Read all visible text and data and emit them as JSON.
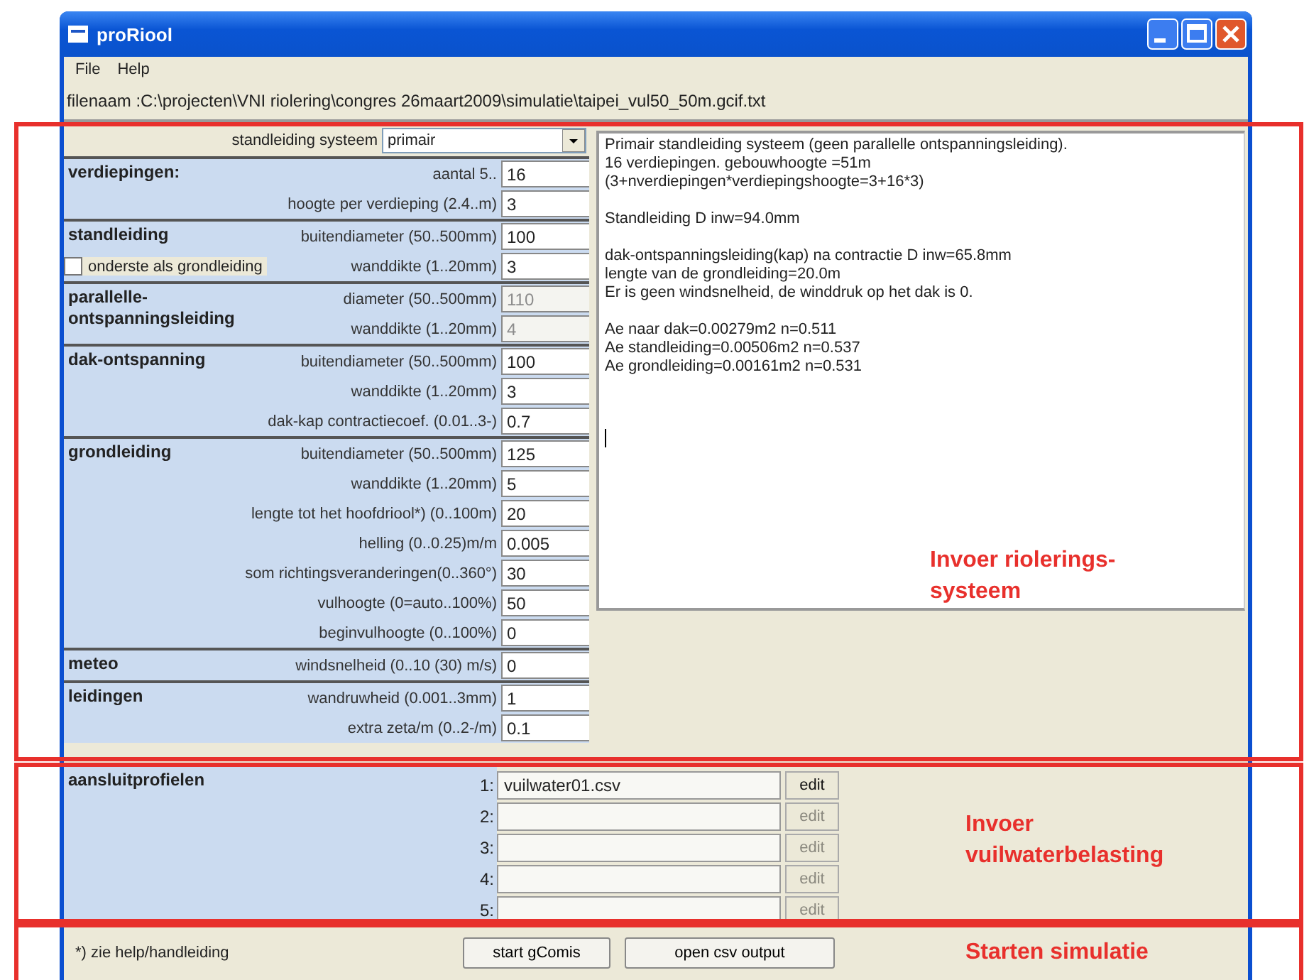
{
  "window": {
    "title": "proRiool"
  },
  "menu": [
    {
      "label": "File"
    },
    {
      "label": "Help"
    }
  ],
  "filename": "filenaam :C:\\projecten\\VNI riolering\\congres 26maart2009\\simulatie\\taipei_vul50_50m.gcif.txt",
  "system": {
    "label": "standleiding systeem",
    "value": "primair"
  },
  "groups": [
    {
      "title": "verdiepingen:",
      "rows": [
        {
          "label": "aantal 5..",
          "value": "16",
          "disabled": false
        },
        {
          "label": "hoogte per verdieping (2.4..m)",
          "value": "3",
          "disabled": false
        }
      ]
    },
    {
      "title": "standleiding",
      "rows": [
        {
          "label": "buitendiameter (50..500mm)",
          "value": "100",
          "disabled": false
        },
        {
          "label": "wanddikte (1..20mm)",
          "value": "3",
          "disabled": false,
          "checkbox": {
            "label": "onderste als grondleiding",
            "checked": false
          }
        }
      ]
    },
    {
      "title": "parallelle-ontspanningsleiding",
      "rows": [
        {
          "label": "diameter (50..500mm)",
          "value": "110",
          "disabled": true
        },
        {
          "label": "wanddikte (1..20mm)",
          "value": "4",
          "disabled": true
        }
      ]
    },
    {
      "title": "dak-ontspanning",
      "rows": [
        {
          "label": "buitendiameter (50..500mm)",
          "value": "100",
          "disabled": false
        },
        {
          "label": "wanddikte (1..20mm)",
          "value": "3",
          "disabled": false
        },
        {
          "label": "dak-kap contractiecoef.  (0.01..3-)",
          "value": "0.7",
          "disabled": false
        }
      ]
    },
    {
      "title": "grondleiding",
      "rows": [
        {
          "label": "buitendiameter (50..500mm)",
          "value": "125",
          "disabled": false
        },
        {
          "label": "wanddikte (1..20mm)",
          "value": "5",
          "disabled": false
        },
        {
          "label": "lengte tot het hoofdriool*) (0..100m)",
          "value": "20",
          "disabled": false
        },
        {
          "label": "helling (0..0.25)m/m",
          "value": "0.005",
          "disabled": false
        },
        {
          "label": "som richtingsveranderingen(0..360°)",
          "value": "30",
          "disabled": false
        },
        {
          "label": "vulhoogte (0=auto..100%)",
          "value": "50",
          "disabled": false
        },
        {
          "label": "beginvulhoogte (0..100%)",
          "value": "0",
          "disabled": false
        }
      ]
    },
    {
      "title": "meteo",
      "rows": [
        {
          "label": "windsnelheid (0..10 (30) m/s)",
          "value": "0",
          "disabled": false
        }
      ]
    },
    {
      "title": "leidingen",
      "rows": [
        {
          "label": "wandruwheid (0.001..3mm)",
          "value": "1",
          "disabled": false
        },
        {
          "label": "extra zeta/m  (0..2-/m)",
          "value": "0.1",
          "disabled": false
        }
      ]
    }
  ],
  "output": [
    [
      "Primair standleiding systeem (geen parallelle ontspanningsleiding).",
      "16 verdiepingen. gebouwhoogte =51m",
      "(3+nverdiepingen*verdiepingshoogte=3+16*3)"
    ],
    [
      "Standleiding D inw=94.0mm"
    ],
    [
      "dak-ontspanningsleiding(kap) na contractie D inw=65.8mm",
      "lengte van de grondleiding=20.0m",
      "Er is geen windsnelheid, de winddruk op het dak is 0."
    ],
    [
      "Ae   naar   dak=0.00279m2 n=0.511",
      "Ae standleiding=0.00506m2 n=0.537",
      "Ae grondleiding=0.00161m2 n=0.531"
    ]
  ],
  "profiles": {
    "title": "aansluitprofielen",
    "rows": [
      {
        "number": "1:",
        "value": "vuilwater01.csv",
        "button": "edit",
        "disabled": false
      },
      {
        "number": "2:",
        "button": "edit",
        "disabled": true
      },
      {
        "number": "3:",
        "button": "edit",
        "disabled": true
      },
      {
        "number": "4:",
        "button": "edit",
        "disabled": true
      },
      {
        "number": "5:",
        "button": "edit",
        "disabled": true
      }
    ]
  },
  "note": "*) zie help/handleiding",
  "buttons": [
    "start gComis",
    "open csv output"
  ],
  "annotations": [
    {
      "lines": [
        "Invoer riolerings-",
        "systeem"
      ]
    },
    {
      "lines": [
        "Invoer",
        "vuilwaterbelasting"
      ]
    },
    {
      "lines": [
        "Starten simulatie"
      ]
    }
  ]
}
